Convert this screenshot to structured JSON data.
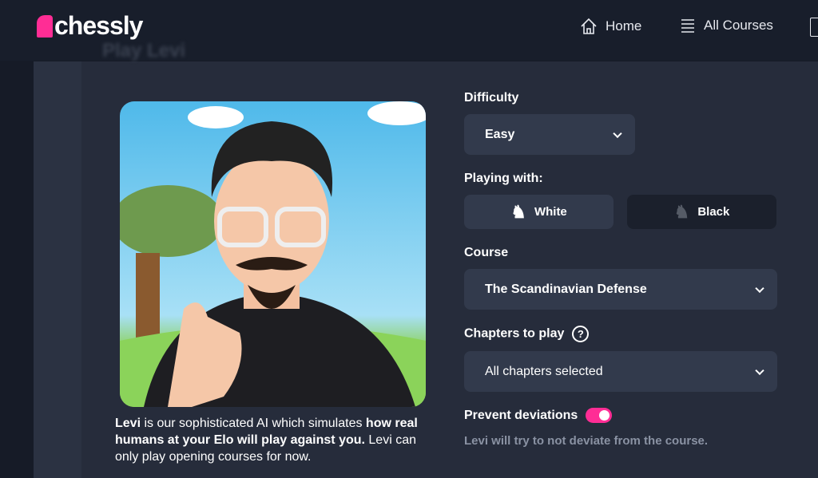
{
  "header": {
    "logo": "chessly",
    "nav": [
      {
        "label": "Home",
        "icon": "home-icon"
      },
      {
        "label": "All Courses",
        "icon": "list-icon"
      }
    ],
    "ghost_title": "Play Levi"
  },
  "avatar": {
    "description_name": "Levi",
    "description_mid": " is our sophisticated AI which simulates ",
    "description_bold": "how real humans at your Elo will play against you.",
    "description_end": " Levi can only play opening courses for now."
  },
  "form": {
    "difficulty_label": "Difficulty",
    "difficulty_value": "Easy",
    "playing_with_label": "Playing with:",
    "white_label": "White",
    "black_label": "Black",
    "selected_color": "Black",
    "course_label": "Course",
    "course_value": "The Scandinavian Defense",
    "chapters_label": "Chapters to play",
    "chapters_value": "All chapters selected",
    "prevent_label": "Prevent deviations",
    "prevent_on": true,
    "prevent_hint": "Levi will try to not deviate from the course."
  },
  "colors": {
    "accent": "#ff2d95",
    "panel": "#262c3b",
    "field": "#323a4c"
  }
}
